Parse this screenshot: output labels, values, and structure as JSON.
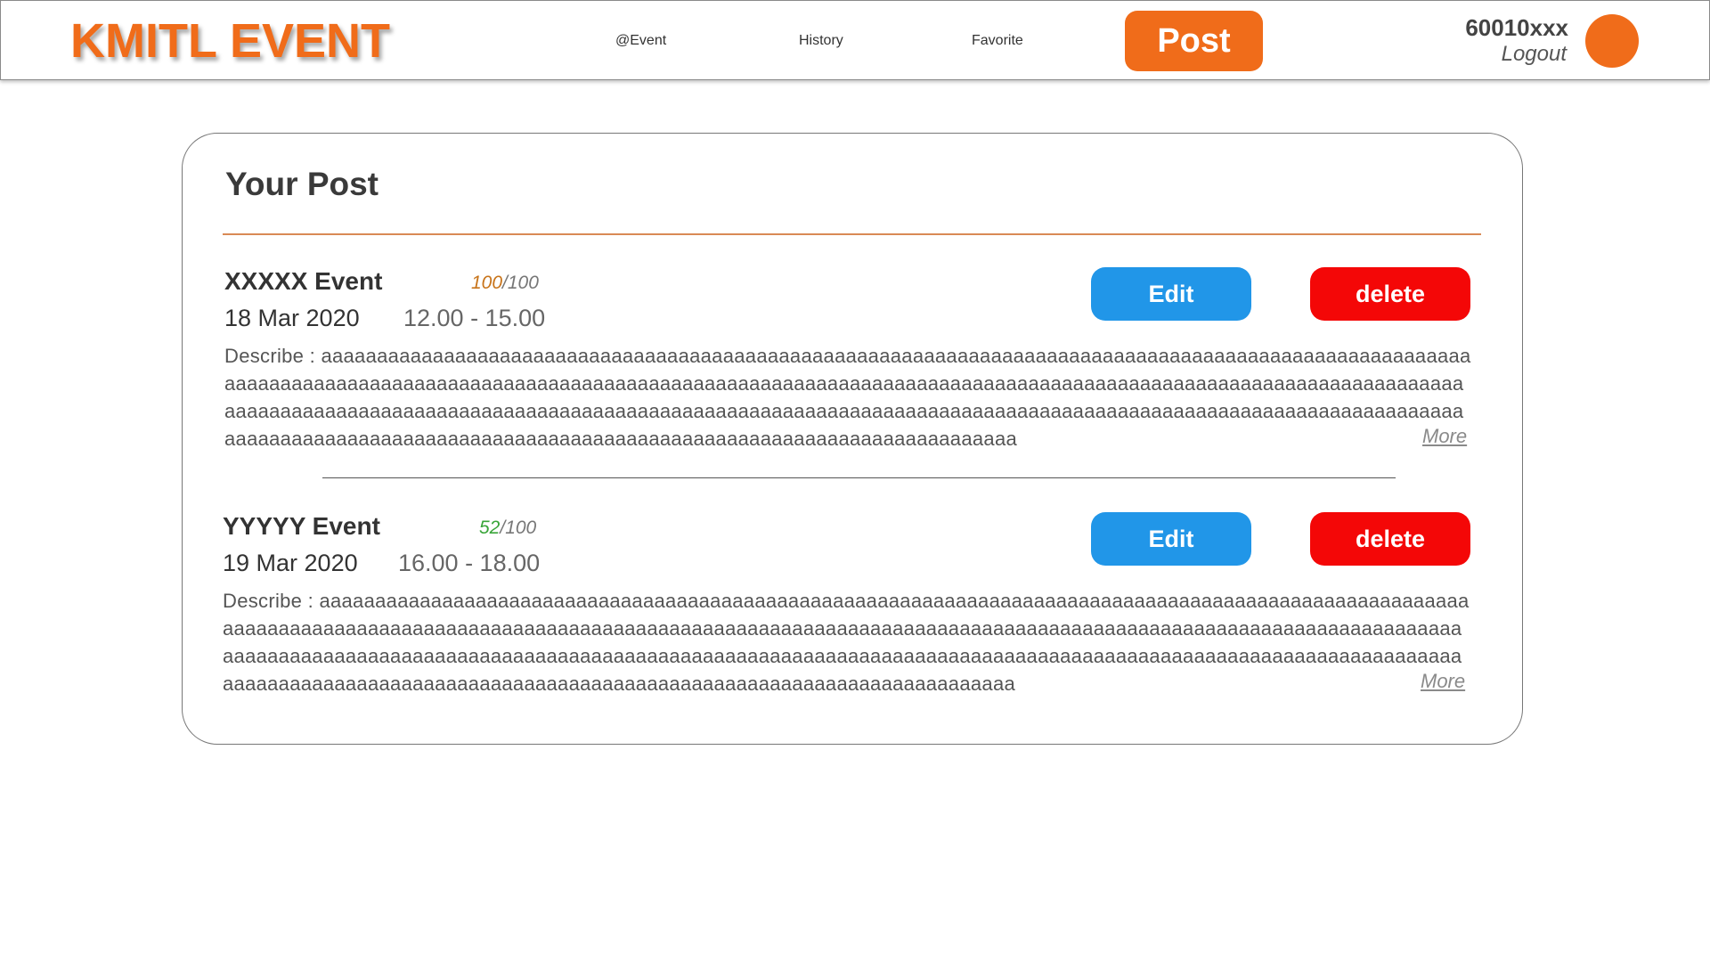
{
  "header": {
    "brand": "KMITL EVENT",
    "nav": {
      "event": "@Event",
      "history": "History",
      "favorite": "Favorite",
      "post": "Post"
    },
    "user_id": "60010xxx",
    "logout": "Logout",
    "accent_color": "#f06c1a"
  },
  "main": {
    "title": "Your Post",
    "edit_label": "Edit",
    "delete_label": "delete",
    "more_label": "More",
    "posts": [
      {
        "name": "XXXXX Event",
        "score": "100",
        "score_total": "/100",
        "score_color": "#c8741a",
        "date": "18 Mar 2020",
        "time": "12.00 - 15.00",
        "describe": "Describe : aaaaaaaaaaaaaaaaaaaaaaaaaaaaaaaaaaaaaaaaaaaaaaaaaaaaaaaaaaaaaaaaaaaaaaaaaaaaaaaaaaaaaaaaaaaaaaaaaaaaaaaaaaaaaaaaaaaaaaaaaaaaaaaaaaaaaaaaaaaaaaaaaaaaaaaaaaaaaaaaaaaaaaaaaaaaaaaaaaaaaaaaaaaaaaaaaaaaaaaaaaaaaaaaaaaaaaaaaaaaaaaaaaaaaaaaaaaaaaaaaaaaaaaaaaaaaaaaaaaaaaaaaaaaaaaaaaaaaaaaaaaaaaaaaaaaaaaaaaaaaaaaaaaaaaaaaaaaaaaaaaaaaaaaaaaaaaaaaaaaaaaaaaaaaaaaaaaaaaaaaaaaaaaaaaaaaaaaaaaaaaaaaaaaaaaaaaaa"
      },
      {
        "name": "YYYYY Event",
        "score": "52",
        "score_total": "/100",
        "score_color": "#3aa53a",
        "date": "19 Mar 2020",
        "time": "16.00 - 18.00",
        "describe": "Describe : aaaaaaaaaaaaaaaaaaaaaaaaaaaaaaaaaaaaaaaaaaaaaaaaaaaaaaaaaaaaaaaaaaaaaaaaaaaaaaaaaaaaaaaaaaaaaaaaaaaaaaaaaaaaaaaaaaaaaaaaaaaaaaaaaaaaaaaaaaaaaaaaaaaaaaaaaaaaaaaaaaaaaaaaaaaaaaaaaaaaaaaaaaaaaaaaaaaaaaaaaaaaaaaaaaaaaaaaaaaaaaaaaaaaaaaaaaaaaaaaaaaaaaaaaaaaaaaaaaaaaaaaaaaaaaaaaaaaaaaaaaaaaaaaaaaaaaaaaaaaaaaaaaaaaaaaaaaaaaaaaaaaaaaaaaaaaaaaaaaaaaaaaaaaaaaaaaaaaaaaaaaaaaaaaaaaaaaaaaaaaaaaaaaaaaaaaaaa"
      }
    ]
  }
}
